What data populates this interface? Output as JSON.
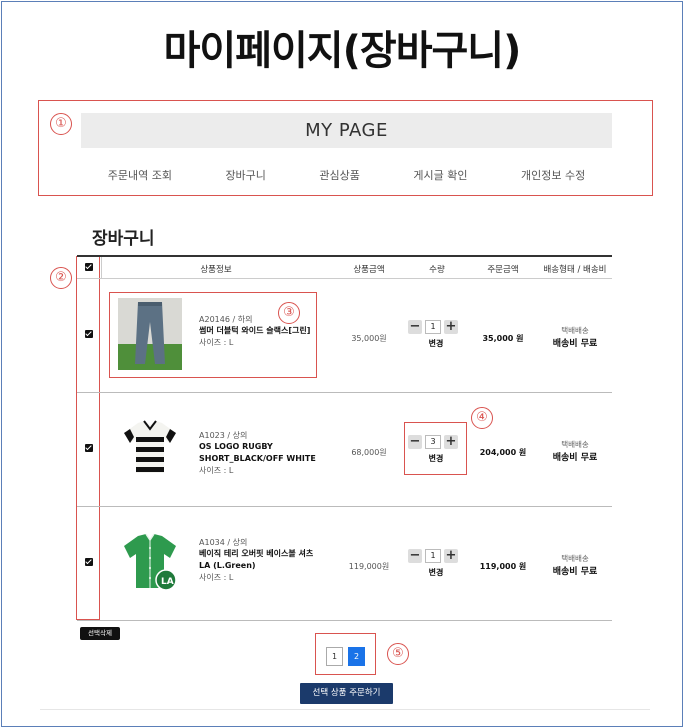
{
  "headline": "마이페이지(장바구니)",
  "markers": [
    "①",
    "②",
    "③",
    "④",
    "⑤"
  ],
  "mypage": {
    "title": "MY PAGE",
    "nav": [
      "주문내역 조회",
      "장바구니",
      "관심상품",
      "게시글 확인",
      "개인정보 수정"
    ]
  },
  "cart": {
    "title": "장바구니",
    "headers": {
      "product": "상품정보",
      "price": "상품금액",
      "qty": "수량",
      "total": "주문금액",
      "shipping": "배송형태 / 배송비"
    },
    "qty_change_label": "변경",
    "items": [
      {
        "code": "A20146 / 하의",
        "name": "썸머 더블턱 와이드 슬랙스[그린]",
        "size": "사이즈 : L",
        "price": "35,000원",
        "qty": "1",
        "total": "35,000 원",
        "ship_type": "택배배송",
        "ship_fee": "배송비 무료",
        "image_icon": "pants-icon"
      },
      {
        "code": "A1023 / 상의",
        "name": "OS LOGO RUGBY SHORT_BLACK/OFF WHITE",
        "size": "사이즈 : L",
        "price": "68,000원",
        "qty": "3",
        "total": "204,000 원",
        "ship_type": "택배배송",
        "ship_fee": "배송비 무료",
        "image_icon": "striped-shirt-icon"
      },
      {
        "code": "A1034 / 상의",
        "name": "베이직 테리 오버핏 베이스볼 셔츠 LA (L.Green)",
        "size": "사이즈 : L",
        "price": "119,000원",
        "qty": "1",
        "total": "119,000 원",
        "ship_type": "택배배송",
        "ship_fee": "배송비 무료",
        "image_icon": "baseball-shirt-icon"
      }
    ],
    "delete_selected": "선택삭제",
    "pages": [
      "1",
      "2"
    ],
    "active_page": "2",
    "order_selected": "선택 상품 주문하기"
  },
  "colors": {
    "annotation_red": "#d9534f",
    "order_button": "#1b3a6b",
    "active_page": "#1a73e8"
  }
}
